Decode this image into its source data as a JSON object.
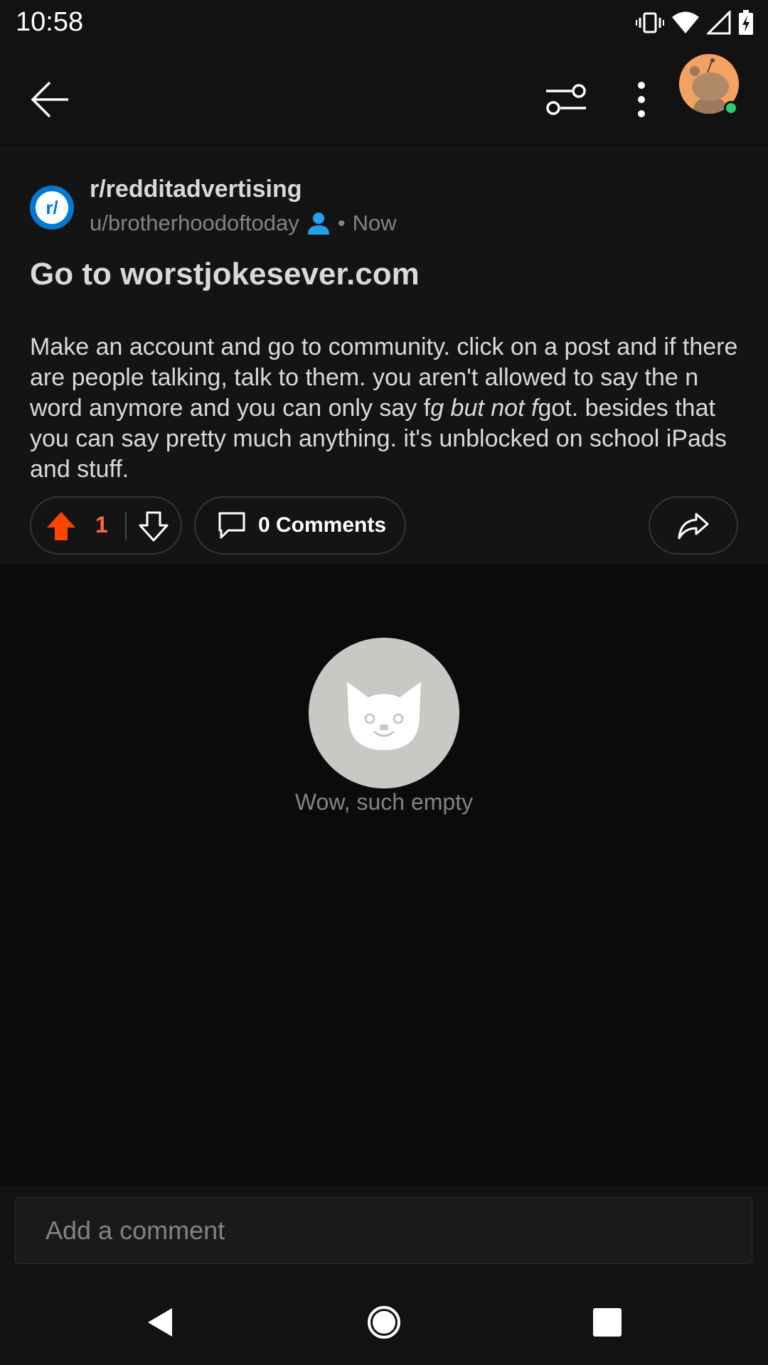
{
  "status_bar": {
    "time": "10:58",
    "icons": [
      "vibrate-icon",
      "wifi-icon",
      "signal-icon",
      "battery-charging-icon"
    ]
  },
  "header": {
    "back_icon": "arrow-left-icon",
    "filter_icon": "sort-sliders-icon",
    "more_icon": "more-vertical-icon",
    "avatar_online": true
  },
  "post": {
    "subreddit": "r/redditadvertising",
    "subreddit_icon_text": "r/",
    "author": "u/brotherhoodoftoday",
    "separator": "•",
    "time": "Now",
    "title": "Go to worstjokesever.com",
    "body_part1": "Make an account and go to community. click on a post and if there are people talking, talk to them. you aren't allowed to say the n word anymore and you can only say f",
    "body_italic": "g but not f",
    "body_part2": "got. besides that you can say pretty much anything. it's unblocked on school iPads and stuff.",
    "vote_count": "1",
    "comments_label": "0 Comments"
  },
  "empty_state": {
    "text": "Wow, such empty"
  },
  "comment_bar": {
    "placeholder": "Add a comment"
  },
  "colors": {
    "upvote": "#ff4500",
    "subreddit_icon": "#0079d3",
    "author_badge": "#24a0ed",
    "online": "#2ecc71"
  }
}
